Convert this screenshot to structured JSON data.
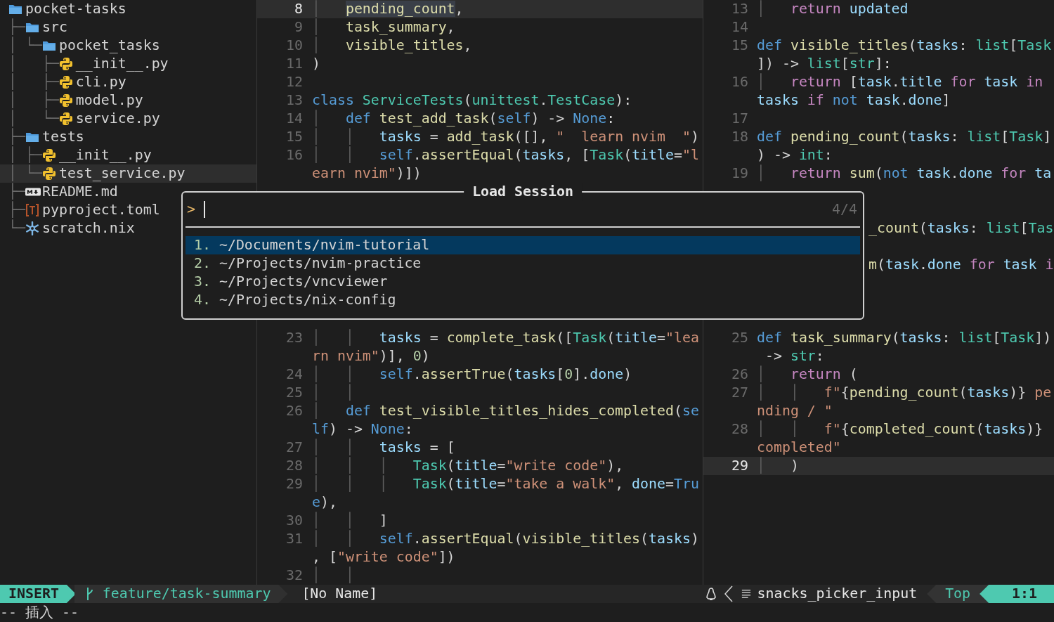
{
  "file_tree": [
    {
      "name": "pocket-tasks",
      "kind": "folder",
      "current": false,
      "children": [
        {
          "guide": "├─",
          "name": "src",
          "kind": "folder",
          "current": false,
          "children": [
            {
              "guide": "│ └─",
              "name": "pocket_tasks",
              "kind": "folder",
              "current": false,
              "children": [
                {
                  "guide": "│   ├─",
                  "name": "__init__.py",
                  "kind": "python",
                  "current": false
                },
                {
                  "guide": "│   ├─",
                  "name": "cli.py",
                  "kind": "python",
                  "current": false
                },
                {
                  "guide": "│   ├─",
                  "name": "model.py",
                  "kind": "python",
                  "current": false
                },
                {
                  "guide": "│   └─",
                  "name": "service.py",
                  "kind": "python",
                  "current": false
                }
              ]
            }
          ]
        },
        {
          "guide": "├─",
          "name": "tests",
          "kind": "folder",
          "current": false,
          "children": [
            {
              "guide": "│ ├─",
              "name": "__init__.py",
              "kind": "python",
              "current": false
            },
            {
              "guide": "│ └─",
              "name": "test_service.py",
              "kind": "python",
              "current": true
            }
          ]
        },
        {
          "guide": "├─",
          "name": "README.md",
          "kind": "markdown",
          "current": false
        },
        {
          "guide": "├─",
          "name": "pyproject.toml",
          "kind": "toml",
          "current": false
        },
        {
          "guide": "└─",
          "name": "scratch.nix",
          "kind": "nix",
          "current": false
        }
      ]
    }
  ],
  "left_window": {
    "lines_top": [
      {
        "number": "8",
        "current": true,
        "tokens": [
          {
            "kind": "guide",
            "text": "│   "
          },
          {
            "kind": "match",
            "text": "pending_count"
          },
          {
            "kind": "plain",
            "text": ","
          }
        ]
      },
      {
        "number": "9",
        "current": false,
        "tokens": [
          {
            "kind": "guide",
            "text": "│   "
          },
          {
            "kind": "fn",
            "text": "task_summary"
          },
          {
            "kind": "plain",
            "text": ","
          }
        ]
      },
      {
        "number": "10",
        "current": false,
        "tokens": [
          {
            "kind": "guide",
            "text": "│   "
          },
          {
            "kind": "fn",
            "text": "visible_titles"
          },
          {
            "kind": "plain",
            "text": ","
          }
        ]
      },
      {
        "number": "11",
        "current": false,
        "tokens": [
          {
            "kind": "plain",
            "text": ")"
          }
        ]
      },
      {
        "number": "12",
        "current": false
      },
      {
        "number": "13",
        "current": false,
        "tokens": [
          {
            "kind": "keyword",
            "text": "class"
          },
          {
            "kind": "type",
            "text": " ServiceTests"
          },
          {
            "kind": "plain",
            "text": "("
          },
          {
            "kind": "type",
            "text": "unittest"
          },
          {
            "kind": "plain",
            "text": "."
          },
          {
            "kind": "type",
            "text": "TestCase"
          },
          {
            "kind": "plain",
            "text": "):"
          }
        ]
      },
      {
        "number": "14",
        "current": false,
        "tokens": [
          {
            "kind": "guide",
            "text": "│   "
          },
          {
            "kind": "keyword",
            "text": "def"
          },
          {
            "kind": "fn",
            "text": " test_add_task"
          },
          {
            "kind": "plain",
            "text": "("
          },
          {
            "kind": "keyword",
            "text": "self"
          },
          {
            "kind": "plain",
            "text": ") -> "
          },
          {
            "kind": "keyword",
            "text": "None"
          },
          {
            "kind": "plain",
            "text": ":"
          }
        ]
      },
      {
        "number": "15",
        "current": false,
        "tokens": [
          {
            "kind": "guide",
            "text": "│   │   "
          },
          {
            "kind": "variable",
            "text": "tasks"
          },
          {
            "kind": "plain",
            "text": " = "
          },
          {
            "kind": "fn",
            "text": "add_task"
          },
          {
            "kind": "plain",
            "text": "([], "
          },
          {
            "kind": "string",
            "text": "\"  learn nvim  \""
          },
          {
            "kind": "plain",
            "text": ")"
          }
        ]
      },
      {
        "number": "16",
        "current": false,
        "tokens": [
          {
            "kind": "guide",
            "text": "│   │   "
          },
          {
            "kind": "keyword",
            "text": "self"
          },
          {
            "kind": "plain",
            "text": "."
          },
          {
            "kind": "fn",
            "text": "assertEqual"
          },
          {
            "kind": "plain",
            "text": "("
          },
          {
            "kind": "variable",
            "text": "tasks"
          },
          {
            "kind": "plain",
            "text": ", ["
          },
          {
            "kind": "type",
            "text": "Task"
          },
          {
            "kind": "plain",
            "text": "("
          },
          {
            "kind": "variable",
            "text": "title"
          },
          {
            "kind": "plain",
            "text": "="
          },
          {
            "kind": "string",
            "text": "\"l"
          }
        ]
      },
      {
        "current": false,
        "tokens": [
          {
            "kind": "string",
            "text": "earn nvim\""
          },
          {
            "kind": "plain",
            "text": ")])"
          }
        ]
      }
    ],
    "lines_bottom": [
      {
        "number": "23",
        "current": false,
        "tokens": [
          {
            "kind": "guide",
            "text": "│   │   "
          },
          {
            "kind": "variable",
            "text": "tasks"
          },
          {
            "kind": "plain",
            "text": " = "
          },
          {
            "kind": "fn",
            "text": "complete_task"
          },
          {
            "kind": "plain",
            "text": "(["
          },
          {
            "kind": "type",
            "text": "Task"
          },
          {
            "kind": "plain",
            "text": "("
          },
          {
            "kind": "variable",
            "text": "title"
          },
          {
            "kind": "plain",
            "text": "="
          },
          {
            "kind": "string",
            "text": "\"lea"
          }
        ]
      },
      {
        "current": false,
        "tokens": [
          {
            "kind": "string",
            "text": "rn nvim\""
          },
          {
            "kind": "plain",
            "text": ")], "
          },
          {
            "kind": "number",
            "text": "0"
          },
          {
            "kind": "plain",
            "text": ")"
          }
        ]
      },
      {
        "number": "24",
        "current": false,
        "tokens": [
          {
            "kind": "guide",
            "text": "│   │   "
          },
          {
            "kind": "keyword",
            "text": "self"
          },
          {
            "kind": "plain",
            "text": "."
          },
          {
            "kind": "fn",
            "text": "assertTrue"
          },
          {
            "kind": "plain",
            "text": "("
          },
          {
            "kind": "variable",
            "text": "tasks"
          },
          {
            "kind": "plain",
            "text": "["
          },
          {
            "kind": "number",
            "text": "0"
          },
          {
            "kind": "plain",
            "text": "]."
          },
          {
            "kind": "variable",
            "text": "done"
          },
          {
            "kind": "plain",
            "text": ")"
          }
        ]
      },
      {
        "number": "25",
        "current": false,
        "tokens": [
          {
            "kind": "guide",
            "text": "│   │"
          }
        ]
      },
      {
        "number": "26",
        "current": false,
        "tokens": [
          {
            "kind": "guide",
            "text": "│   "
          },
          {
            "kind": "keyword",
            "text": "def"
          },
          {
            "kind": "fn",
            "text": " test_visible_titles_hides_completed"
          },
          {
            "kind": "plain",
            "text": "("
          },
          {
            "kind": "keyword",
            "text": "se"
          }
        ]
      },
      {
        "current": false,
        "tokens": [
          {
            "kind": "keyword",
            "text": "lf"
          },
          {
            "kind": "plain",
            "text": ") -> "
          },
          {
            "kind": "keyword",
            "text": "None"
          },
          {
            "kind": "plain",
            "text": ":"
          }
        ]
      },
      {
        "number": "27",
        "current": false,
        "tokens": [
          {
            "kind": "guide",
            "text": "│   │   "
          },
          {
            "kind": "variable",
            "text": "tasks"
          },
          {
            "kind": "plain",
            "text": " = ["
          }
        ]
      },
      {
        "number": "28",
        "current": false,
        "tokens": [
          {
            "kind": "guide",
            "text": "│   │   │   "
          },
          {
            "kind": "type",
            "text": "Task"
          },
          {
            "kind": "plain",
            "text": "("
          },
          {
            "kind": "variable",
            "text": "title"
          },
          {
            "kind": "plain",
            "text": "="
          },
          {
            "kind": "string",
            "text": "\"write code\""
          },
          {
            "kind": "plain",
            "text": "),"
          }
        ]
      },
      {
        "number": "29",
        "current": false,
        "tokens": [
          {
            "kind": "guide",
            "text": "│   │   │   "
          },
          {
            "kind": "type",
            "text": "Task"
          },
          {
            "kind": "plain",
            "text": "("
          },
          {
            "kind": "variable",
            "text": "title"
          },
          {
            "kind": "plain",
            "text": "="
          },
          {
            "kind": "string",
            "text": "\"take a walk\""
          },
          {
            "kind": "plain",
            "text": ", "
          },
          {
            "kind": "variable",
            "text": "done"
          },
          {
            "kind": "plain",
            "text": "="
          },
          {
            "kind": "keyword",
            "text": "Tru"
          }
        ]
      },
      {
        "current": false,
        "tokens": [
          {
            "kind": "keyword",
            "text": "e"
          },
          {
            "kind": "plain",
            "text": "),"
          }
        ]
      },
      {
        "number": "30",
        "current": false,
        "tokens": [
          {
            "kind": "guide",
            "text": "│   │   "
          },
          {
            "kind": "plain",
            "text": "]"
          }
        ]
      },
      {
        "number": "31",
        "current": false,
        "tokens": [
          {
            "kind": "guide",
            "text": "│   │   "
          },
          {
            "kind": "keyword",
            "text": "self"
          },
          {
            "kind": "plain",
            "text": "."
          },
          {
            "kind": "fn",
            "text": "assertEqual"
          },
          {
            "kind": "plain",
            "text": "("
          },
          {
            "kind": "fn",
            "text": "visible_titles"
          },
          {
            "kind": "plain",
            "text": "("
          },
          {
            "kind": "variable",
            "text": "tasks"
          },
          {
            "kind": "plain",
            "text": ")"
          }
        ]
      },
      {
        "current": false,
        "tokens": [
          {
            "kind": "plain",
            "text": ", ["
          },
          {
            "kind": "string",
            "text": "\"write code\""
          },
          {
            "kind": "plain",
            "text": "])"
          }
        ]
      },
      {
        "number": "32",
        "current": false,
        "tokens": [
          {
            "kind": "guide",
            "text": "│   │"
          }
        ]
      }
    ]
  },
  "right_window": {
    "lines_top": [
      {
        "number": "13",
        "current": false,
        "tokens": [
          {
            "kind": "guide",
            "text": "│   "
          },
          {
            "kind": "control",
            "text": "return"
          },
          {
            "kind": "variable",
            "text": " updated"
          }
        ]
      },
      {
        "number": "14",
        "current": false
      },
      {
        "number": "15",
        "current": false,
        "tokens": [
          {
            "kind": "keyword",
            "text": "def"
          },
          {
            "kind": "fn",
            "text": " visible_titles"
          },
          {
            "kind": "plain",
            "text": "("
          },
          {
            "kind": "variable",
            "text": "tasks"
          },
          {
            "kind": "plain",
            "text": ": "
          },
          {
            "kind": "type",
            "text": "list"
          },
          {
            "kind": "plain",
            "text": "["
          },
          {
            "kind": "type",
            "text": "Task"
          }
        ]
      },
      {
        "current": false,
        "tokens": [
          {
            "kind": "plain",
            "text": "]) -> "
          },
          {
            "kind": "type",
            "text": "list"
          },
          {
            "kind": "plain",
            "text": "["
          },
          {
            "kind": "type",
            "text": "str"
          },
          {
            "kind": "plain",
            "text": "]:"
          }
        ]
      },
      {
        "number": "16",
        "current": false,
        "tokens": [
          {
            "kind": "guide",
            "text": "│   "
          },
          {
            "kind": "control",
            "text": "return"
          },
          {
            "kind": "plain",
            "text": " ["
          },
          {
            "kind": "variable",
            "text": "task"
          },
          {
            "kind": "plain",
            "text": "."
          },
          {
            "kind": "variable",
            "text": "title"
          },
          {
            "kind": "control",
            "text": " for"
          },
          {
            "kind": "variable",
            "text": " task"
          },
          {
            "kind": "control",
            "text": " in"
          }
        ]
      },
      {
        "current": false,
        "tokens": [
          {
            "kind": "variable",
            "text": "tasks"
          },
          {
            "kind": "control",
            "text": " if"
          },
          {
            "kind": "keyword",
            "text": " not"
          },
          {
            "kind": "variable",
            "text": " task"
          },
          {
            "kind": "plain",
            "text": "."
          },
          {
            "kind": "variable",
            "text": "done"
          },
          {
            "kind": "plain",
            "text": "]"
          }
        ]
      },
      {
        "number": "17",
        "current": false
      },
      {
        "number": "18",
        "current": false,
        "tokens": [
          {
            "kind": "keyword",
            "text": "def"
          },
          {
            "kind": "fn",
            "text": " pending_count"
          },
          {
            "kind": "plain",
            "text": "("
          },
          {
            "kind": "variable",
            "text": "tasks"
          },
          {
            "kind": "plain",
            "text": ": "
          },
          {
            "kind": "type",
            "text": "list"
          },
          {
            "kind": "plain",
            "text": "["
          },
          {
            "kind": "type",
            "text": "Task"
          },
          {
            "kind": "plain",
            "text": "]"
          }
        ]
      },
      {
        "current": false,
        "tokens": [
          {
            "kind": "plain",
            "text": ") -> "
          },
          {
            "kind": "type",
            "text": "int"
          },
          {
            "kind": "plain",
            "text": ":"
          }
        ]
      },
      {
        "number": "19",
        "current": false,
        "tokens": [
          {
            "kind": "guide",
            "text": "│   "
          },
          {
            "kind": "control",
            "text": "return"
          },
          {
            "kind": "fn",
            "text": " sum"
          },
          {
            "kind": "plain",
            "text": "("
          },
          {
            "kind": "keyword",
            "text": "not"
          },
          {
            "kind": "variable",
            "text": " task"
          },
          {
            "kind": "plain",
            "text": "."
          },
          {
            "kind": "variable",
            "text": "done"
          },
          {
            "kind": "control",
            "text": " for"
          },
          {
            "kind": "variable",
            "text": " ta"
          }
        ]
      }
    ],
    "lines_beside_popup": [
      {
        "tokens": [
          {
            "kind": "fn",
            "text": "_count"
          },
          {
            "kind": "plain",
            "text": "("
          },
          {
            "kind": "variable",
            "text": "tasks"
          },
          {
            "kind": "plain",
            "text": ": "
          },
          {
            "kind": "type",
            "text": "list"
          },
          {
            "kind": "plain",
            "text": "["
          },
          {
            "kind": "type",
            "text": "Tas"
          }
        ]
      },
      {
        "tokens": [
          {
            "kind": "fn",
            "text": "m"
          },
          {
            "kind": "plain",
            "text": "("
          },
          {
            "kind": "variable",
            "text": "task"
          },
          {
            "kind": "plain",
            "text": "."
          },
          {
            "kind": "variable",
            "text": "done"
          },
          {
            "kind": "control",
            "text": " for"
          },
          {
            "kind": "variable",
            "text": " task"
          },
          {
            "kind": "control",
            "text": " i"
          }
        ]
      }
    ],
    "lines_bottom": [
      {
        "number": "25",
        "current": false,
        "tokens": [
          {
            "kind": "keyword",
            "text": "def"
          },
          {
            "kind": "fn",
            "text": " task_summary"
          },
          {
            "kind": "plain",
            "text": "("
          },
          {
            "kind": "variable",
            "text": "tasks"
          },
          {
            "kind": "plain",
            "text": ": "
          },
          {
            "kind": "type",
            "text": "list"
          },
          {
            "kind": "plain",
            "text": "["
          },
          {
            "kind": "type",
            "text": "Task"
          },
          {
            "kind": "plain",
            "text": "])"
          }
        ]
      },
      {
        "current": false,
        "tokens": [
          {
            "kind": "plain",
            "text": " -> "
          },
          {
            "kind": "type",
            "text": "str"
          },
          {
            "kind": "plain",
            "text": ":"
          }
        ]
      },
      {
        "number": "26",
        "current": false,
        "tokens": [
          {
            "kind": "guide",
            "text": "│   "
          },
          {
            "kind": "control",
            "text": "return"
          },
          {
            "kind": "plain",
            "text": " ("
          }
        ]
      },
      {
        "number": "27",
        "current": false,
        "tokens": [
          {
            "kind": "guide",
            "text": "│   │   "
          },
          {
            "kind": "string",
            "text": "f\""
          },
          {
            "kind": "plain",
            "text": "{"
          },
          {
            "kind": "fn",
            "text": "pending_count"
          },
          {
            "kind": "plain",
            "text": "("
          },
          {
            "kind": "variable",
            "text": "tasks"
          },
          {
            "kind": "plain",
            "text": ")}"
          },
          {
            "kind": "string",
            "text": " pe"
          }
        ]
      },
      {
        "current": false,
        "tokens": [
          {
            "kind": "string",
            "text": "nding / \""
          }
        ]
      },
      {
        "number": "28",
        "current": false,
        "tokens": [
          {
            "kind": "guide",
            "text": "│   │   "
          },
          {
            "kind": "string",
            "text": "f\""
          },
          {
            "kind": "plain",
            "text": "{"
          },
          {
            "kind": "fn",
            "text": "completed_count"
          },
          {
            "kind": "plain",
            "text": "("
          },
          {
            "kind": "variable",
            "text": "tasks"
          },
          {
            "kind": "plain",
            "text": ")}"
          }
        ]
      },
      {
        "current": false,
        "tokens": [
          {
            "kind": "string",
            "text": "completed\""
          }
        ]
      },
      {
        "number": "29",
        "current": true,
        "tokens": [
          {
            "kind": "guide",
            "text": "│   "
          },
          {
            "kind": "plain",
            "text": ")"
          }
        ]
      }
    ]
  },
  "popup": {
    "title": "Load Session",
    "prompt": ">",
    "count": "4/4",
    "items": [
      {
        "index": "1.",
        "path": "~/Documents/nvim-tutorial",
        "selected": true
      },
      {
        "index": "2.",
        "path": "~/Projects/nvim-practice",
        "selected": false
      },
      {
        "index": "3.",
        "path": "~/Projects/vncviewer",
        "selected": false
      },
      {
        "index": "4.",
        "path": "~/Projects/nix-config",
        "selected": false
      }
    ]
  },
  "status_line": {
    "mode": "INSERT",
    "branch": "feature/task-summary",
    "file": "[No Name]",
    "filetype": "snacks_picker_input",
    "position": "Top",
    "cursor": "1:1"
  },
  "command_line": "-- 插入 --"
}
